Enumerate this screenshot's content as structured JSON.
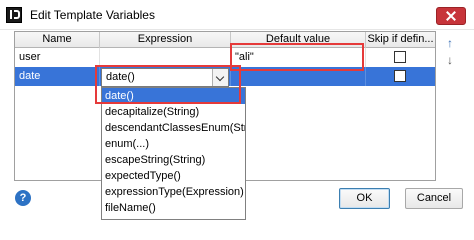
{
  "window": {
    "title": "Edit Template Variables"
  },
  "table": {
    "columns": [
      "Name",
      "Expression",
      "Default value",
      "Skip if defin..."
    ],
    "rows": [
      {
        "name": "user",
        "expression": "",
        "default_value": "\"ali\"",
        "skip": false,
        "selected": false
      },
      {
        "name": "date",
        "expression": "date()",
        "default_value": "",
        "skip": false,
        "selected": true
      }
    ]
  },
  "expression_combo": {
    "value": "date()"
  },
  "expression_options": [
    "date()",
    "decapitalize(String)",
    "descendantClassesEnum(Strin",
    "enum(...)",
    "escapeString(String)",
    "expectedType()",
    "expressionType(Expression)",
    "fileName()"
  ],
  "selected_option_index": 0,
  "toolbar": {
    "move_up": "↑",
    "move_down": "↓"
  },
  "footer": {
    "help": "?",
    "ok": "OK",
    "cancel": "Cancel"
  },
  "colors": {
    "selection": "#3874d8",
    "annotation": "#e53a3a",
    "close": "#c7343a"
  }
}
